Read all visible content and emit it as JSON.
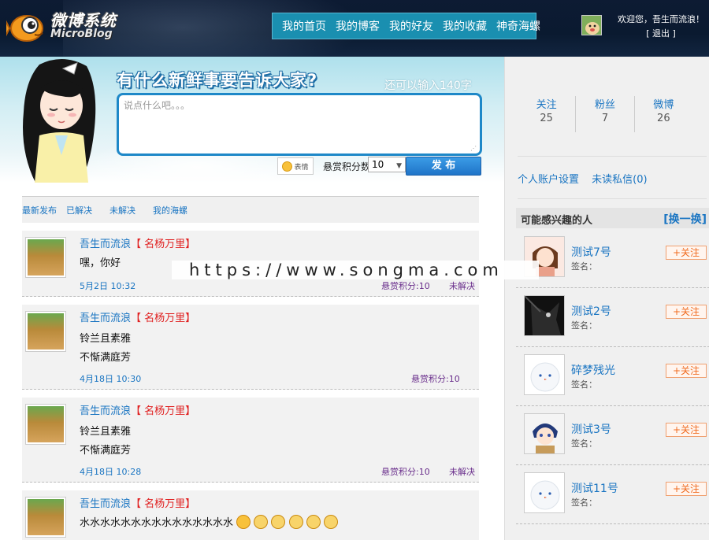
{
  "header": {
    "logo_title": "微博系统",
    "logo_sub": "MicroBlog",
    "nav": [
      "我的首页",
      "我的博客",
      "我的好友",
      "我的收藏",
      "神奇海螺"
    ],
    "welcome": "欢迎您，吾生而流浪！",
    "logout": "[ 退出 ]"
  },
  "composer": {
    "title": "有什么新鲜事要告诉大家?",
    "remaining": "还可以输入140字",
    "placeholder": "说点什么吧。。。",
    "emoji_label": "表情",
    "reward_label": "悬赏积分数",
    "reward_value": "10",
    "publish_label": "发 布"
  },
  "tabs": [
    "最新发布",
    "已解决",
    "未解决",
    "我的海螺"
  ],
  "feed": [
    {
      "name": "吾生而流浪",
      "tag": "【 名杨万里】",
      "lines": [
        "嘿，你好"
      ],
      "time": "5月2日 10:32",
      "reward": "悬赏积分:10",
      "status": "未解决"
    },
    {
      "name": "吾生而流浪",
      "tag": "【 名杨万里】",
      "lines": [
        "铃兰且素雅",
        "不惭满庭芳"
      ],
      "time": "4月18日 10:30",
      "reward": "悬赏积分:10",
      "status": ""
    },
    {
      "name": "吾生而流浪",
      "tag": "【 名杨万里】",
      "lines": [
        "铃兰且素雅",
        "不惭满庭芳"
      ],
      "time": "4月18日 10:28",
      "reward": "悬赏积分:10",
      "status": "未解决"
    },
    {
      "name": "吾生而流浪",
      "tag": "【 名杨万里】",
      "lines": [
        "水水水水水水水水水水水水水水水"
      ],
      "time": "",
      "reward": "",
      "status": ""
    }
  ],
  "sidebar": {
    "stats": [
      {
        "label": "关注",
        "value": "25"
      },
      {
        "label": "粉丝",
        "value": "7"
      },
      {
        "label": "微博",
        "value": "26"
      }
    ],
    "links": [
      "个人账户设置",
      "未读私信(0)"
    ],
    "interest_title": "可能感兴趣的人",
    "swap_label": "[换一换]",
    "people": [
      {
        "name": "测试7号",
        "sign": "签名：",
        "follow": "+关注",
        "avatar": "girl-icon"
      },
      {
        "name": "测试2号",
        "sign": "签名：",
        "follow": "+关注",
        "avatar": "dark-figure-icon"
      },
      {
        "name": "碎梦残光",
        "sign": "签名：",
        "follow": "+关注",
        "avatar": "snowman-icon"
      },
      {
        "name": "测试3号",
        "sign": "签名：",
        "follow": "+关注",
        "avatar": "anime-boy-icon"
      },
      {
        "name": "测试11号",
        "sign": "签名：",
        "follow": "+关注",
        "avatar": "snowman-icon"
      }
    ]
  },
  "watermark": "https://www.songma.com"
}
